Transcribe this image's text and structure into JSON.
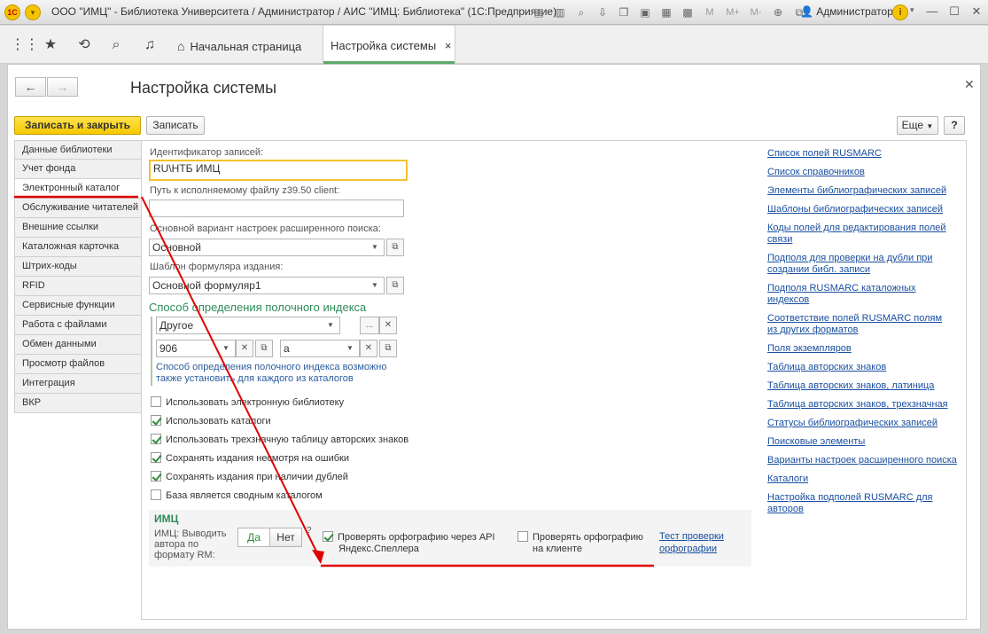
{
  "titlebar": {
    "logo": "1С",
    "title": "ООО \"ИМЦ\" - Библиотека Университета / Администратор / АИС \"ИМЦ: Библиотека\" (1С:Предприятие)",
    "m_buttons": [
      "M",
      "M+",
      "M-"
    ],
    "user": "Администратор",
    "info": "i"
  },
  "topbar": {
    "tabs": [
      {
        "label": "Начальная страница"
      },
      {
        "label": "Настройка системы",
        "close": "×"
      }
    ]
  },
  "form": {
    "title": "Настройка системы",
    "save_close": "Записать и закрыть",
    "save": "Записать",
    "more": "Еще",
    "help": "?"
  },
  "nav": {
    "items": [
      "Данные библиотеки",
      "Учет фонда",
      "Электронный каталог",
      "Обслуживание читателей",
      "Внешние ссылки",
      "Каталожная карточка",
      "Штрих-коды",
      "RFID",
      "Сервисные функции",
      "Работа с файлами",
      "Обмен данными",
      "Просмотр файлов",
      "Интеграция",
      "ВКР"
    ],
    "active_index": 2
  },
  "fields": {
    "record_id_label": "Идентификатор записей:",
    "record_id_value": "RU\\НТБ ИМЦ",
    "z3950_label": "Путь к исполняемому файлу z39.50 client:",
    "z3950_value": "",
    "search_label": "Основной вариант настроек расширенного поиска:",
    "search_value": "Основной",
    "template_label": "Шаблон формуляра издания:",
    "template_value": "Основной формуляр1"
  },
  "shelf": {
    "title": "Способ определения полочного индекса",
    "method": "Другое",
    "ellipsis": "...",
    "code1": "906",
    "code2": "a",
    "hint_line1": "Способ определения полочного индекса возможно",
    "hint_line2": "также установить для каждого из каталогов"
  },
  "checkboxes": [
    {
      "label": "Использовать электронную библиотеку",
      "checked": false
    },
    {
      "label": "Использовать каталоги",
      "checked": true
    },
    {
      "label": "Использовать трехзначную таблицу авторских знаков",
      "checked": true
    },
    {
      "label": "Сохранять издания несмотря на ошибки",
      "checked": true
    },
    {
      "label": "Сохранять издания при наличии дублей",
      "checked": true
    },
    {
      "label": "База является сводным каталогом",
      "checked": false
    }
  ],
  "imc": {
    "title": "ИМЦ",
    "rm_label_1": "ИМЦ: Выводить",
    "rm_label_2": "автора по",
    "rm_label_3": "формату RM:",
    "yes": "Да",
    "no": "Нет",
    "question": "?",
    "api_check_1": "Проверять орфографию через API",
    "api_check_2": "Яндекс.Спеллера",
    "client_check_1": "Проверять орфографию",
    "client_check_2": "на клиенте",
    "test_link_1": "Тест проверки",
    "test_link_2": "орфографии"
  },
  "links": [
    [
      "Список полей RUSMARC"
    ],
    [
      "Список справочников"
    ],
    [
      "Элементы библиографических записей"
    ],
    [
      "Шаблоны библиографических записей"
    ],
    [
      "Коды полей для редактирования полей",
      "связи"
    ],
    [
      "Подполя для проверки на дубли при",
      "создании библ. записи"
    ],
    [
      "Подполя RUSMARC каталожных",
      "индексов"
    ],
    [
      "Соответствие полей RUSMARC полям",
      "из других форматов"
    ],
    [
      "Поля экземпляров"
    ],
    [
      "Таблица авторских знаков"
    ],
    [
      "Таблица авторских знаков, латиница"
    ],
    [
      "Таблица авторских знаков, трехзначная"
    ],
    [
      "Статусы библиографических записей"
    ],
    [
      "Поисковые элементы"
    ],
    [
      "Варианты настроек расширенного поиска"
    ],
    [
      "Каталоги"
    ],
    [
      "Настройка подполей RUSMARC для",
      "авторов"
    ]
  ],
  "colors": {
    "accent_yellow": "#f5c800",
    "annotation_red": "#e00000",
    "section_green": "#2e8b57",
    "link_blue": "#1a4fa0"
  }
}
